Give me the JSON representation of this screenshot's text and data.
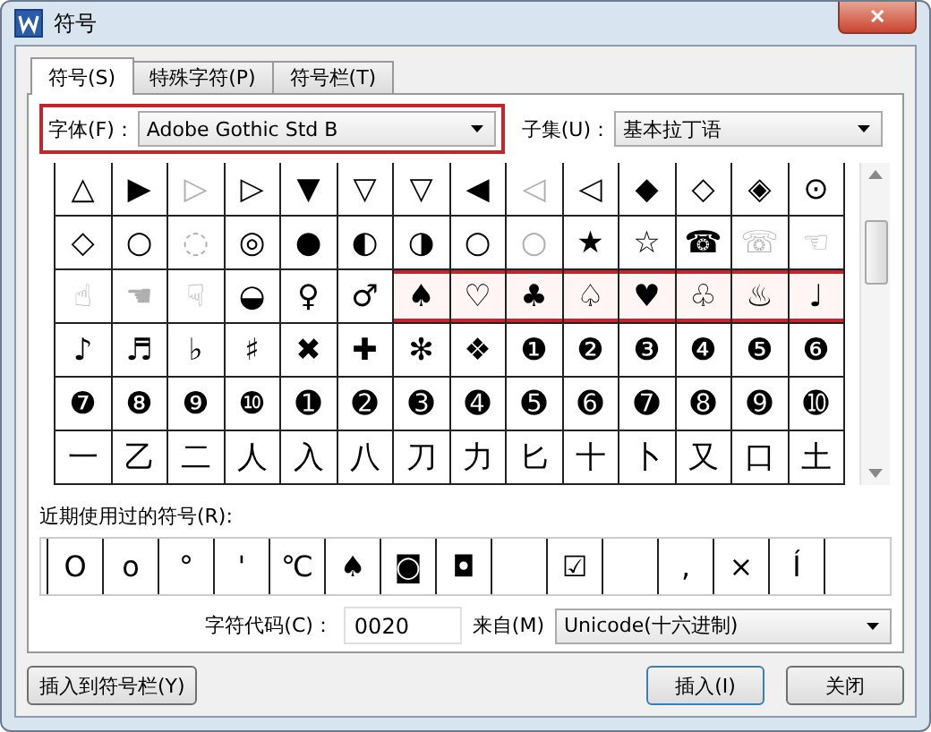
{
  "window": {
    "title": "符号",
    "close": "✕"
  },
  "tabs": [
    {
      "label": "符号(S)",
      "selected": true
    },
    {
      "label": "特殊字符(P)",
      "selected": false
    },
    {
      "label": "符号栏(T)",
      "selected": false
    }
  ],
  "font": {
    "label": "字体(F)：",
    "value": "Adobe Gothic Std B",
    "highlighted": true
  },
  "subset": {
    "label": "子集(U)：",
    "value": "基本拉丁语"
  },
  "grid": [
    [
      {
        "ch": "△",
        "faded": false,
        "highlighted": false
      },
      {
        "ch": "▶",
        "faded": false,
        "highlighted": false
      },
      {
        "ch": "▷",
        "faded": true,
        "highlighted": false
      },
      {
        "ch": "▷",
        "faded": false,
        "highlighted": false
      },
      {
        "ch": "▼",
        "faded": false,
        "highlighted": false
      },
      {
        "ch": "▽",
        "faded": false,
        "highlighted": false
      },
      {
        "ch": "▽",
        "faded": false,
        "highlighted": false
      },
      {
        "ch": "◀",
        "faded": false,
        "highlighted": false
      },
      {
        "ch": "◁",
        "faded": true,
        "highlighted": false
      },
      {
        "ch": "◁",
        "faded": false,
        "highlighted": false
      },
      {
        "ch": "◆",
        "faded": false,
        "highlighted": false
      },
      {
        "ch": "◇",
        "faded": false,
        "highlighted": false
      },
      {
        "ch": "◈",
        "faded": false,
        "highlighted": false
      },
      {
        "ch": "⊙",
        "faded": false,
        "highlighted": false
      }
    ],
    [
      {
        "ch": "◇",
        "faded": false,
        "highlighted": false
      },
      {
        "ch": "○",
        "faded": false,
        "highlighted": false
      },
      {
        "ch": "◌",
        "faded": true,
        "highlighted": false
      },
      {
        "ch": "◎",
        "faded": false,
        "highlighted": false
      },
      {
        "ch": "●",
        "faded": false,
        "highlighted": false
      },
      {
        "ch": "◐",
        "faded": false,
        "highlighted": false
      },
      {
        "ch": "◑",
        "faded": false,
        "highlighted": false
      },
      {
        "ch": "○",
        "faded": false,
        "highlighted": false
      },
      {
        "ch": "○",
        "faded": true,
        "highlighted": false
      },
      {
        "ch": "★",
        "faded": false,
        "highlighted": false
      },
      {
        "ch": "☆",
        "faded": false,
        "highlighted": false
      },
      {
        "ch": "☎",
        "faded": false,
        "highlighted": false
      },
      {
        "ch": "☏",
        "faded": true,
        "highlighted": false
      },
      {
        "ch": "☜",
        "faded": true,
        "highlighted": false
      }
    ],
    [
      {
        "ch": "☝",
        "faded": true,
        "highlighted": false
      },
      {
        "ch": "☚",
        "faded": true,
        "highlighted": false
      },
      {
        "ch": "☟",
        "faded": true,
        "highlighted": false
      },
      {
        "ch": "◒",
        "faded": false,
        "highlighted": false
      },
      {
        "ch": "♀",
        "faded": false,
        "highlighted": false
      },
      {
        "ch": "♂",
        "faded": false,
        "highlighted": false
      },
      {
        "ch": "♠",
        "faded": false,
        "highlighted": true
      },
      {
        "ch": "♡",
        "faded": false,
        "highlighted": true
      },
      {
        "ch": "♣",
        "faded": false,
        "highlighted": true
      },
      {
        "ch": "♤",
        "faded": false,
        "highlighted": true
      },
      {
        "ch": "♥",
        "faded": false,
        "highlighted": true
      },
      {
        "ch": "♧",
        "faded": false,
        "highlighted": true
      },
      {
        "ch": "♨",
        "faded": false,
        "highlighted": true
      },
      {
        "ch": "♩",
        "faded": false,
        "highlighted": true
      }
    ],
    [
      {
        "ch": "♪",
        "faded": false,
        "highlighted": false
      },
      {
        "ch": "♬",
        "faded": false,
        "highlighted": false
      },
      {
        "ch": "♭",
        "faded": false,
        "highlighted": false
      },
      {
        "ch": "♯",
        "faded": false,
        "highlighted": false
      },
      {
        "ch": "✖",
        "faded": false,
        "highlighted": false
      },
      {
        "ch": "✚",
        "faded": false,
        "highlighted": false
      },
      {
        "ch": "✻",
        "faded": false,
        "highlighted": false
      },
      {
        "ch": "❖",
        "faded": false,
        "highlighted": false
      },
      {
        "ch": "❶",
        "faded": false,
        "highlighted": false
      },
      {
        "ch": "❷",
        "faded": false,
        "highlighted": false
      },
      {
        "ch": "❸",
        "faded": false,
        "highlighted": false
      },
      {
        "ch": "❹",
        "faded": false,
        "highlighted": false
      },
      {
        "ch": "❺",
        "faded": false,
        "highlighted": false
      },
      {
        "ch": "❻",
        "faded": false,
        "highlighted": false
      }
    ],
    [
      {
        "ch": "❼",
        "faded": false,
        "highlighted": false
      },
      {
        "ch": "❽",
        "faded": false,
        "highlighted": false
      },
      {
        "ch": "❾",
        "faded": false,
        "highlighted": false
      },
      {
        "ch": "❿",
        "faded": false,
        "highlighted": false
      },
      {
        "ch": "➊",
        "faded": false,
        "highlighted": false
      },
      {
        "ch": "➋",
        "faded": false,
        "highlighted": false
      },
      {
        "ch": "➌",
        "faded": false,
        "highlighted": false
      },
      {
        "ch": "➍",
        "faded": false,
        "highlighted": false
      },
      {
        "ch": "➎",
        "faded": false,
        "highlighted": false
      },
      {
        "ch": "➏",
        "faded": false,
        "highlighted": false
      },
      {
        "ch": "➐",
        "faded": false,
        "highlighted": false
      },
      {
        "ch": "➑",
        "faded": false,
        "highlighted": false
      },
      {
        "ch": "➒",
        "faded": false,
        "highlighted": false
      },
      {
        "ch": "➓",
        "faded": false,
        "highlighted": false
      }
    ],
    [
      {
        "ch": "一",
        "faded": false,
        "highlighted": false
      },
      {
        "ch": "乙",
        "faded": false,
        "highlighted": false
      },
      {
        "ch": "二",
        "faded": false,
        "highlighted": false
      },
      {
        "ch": "人",
        "faded": false,
        "highlighted": false
      },
      {
        "ch": "入",
        "faded": false,
        "highlighted": false
      },
      {
        "ch": "八",
        "faded": false,
        "highlighted": false
      },
      {
        "ch": "刀",
        "faded": false,
        "highlighted": false
      },
      {
        "ch": "力",
        "faded": false,
        "highlighted": false
      },
      {
        "ch": "匕",
        "faded": false,
        "highlighted": false
      },
      {
        "ch": "十",
        "faded": false,
        "highlighted": false
      },
      {
        "ch": "卜",
        "faded": false,
        "highlighted": false
      },
      {
        "ch": "又",
        "faded": false,
        "highlighted": false
      },
      {
        "ch": "口",
        "faded": false,
        "highlighted": false
      },
      {
        "ch": "土",
        "faded": false,
        "highlighted": false
      }
    ]
  ],
  "recent": {
    "label": "近期使用过的符号(R):",
    "items": [
      {
        "kind": "char",
        "ch": "O"
      },
      {
        "kind": "char",
        "ch": "o"
      },
      {
        "kind": "char",
        "ch": "°"
      },
      {
        "kind": "char",
        "ch": "'"
      },
      {
        "kind": "char",
        "ch": "℃"
      },
      {
        "kind": "char",
        "ch": "♠"
      },
      {
        "kind": "char",
        "ch": "◙"
      },
      {
        "kind": "char",
        "ch": "◘"
      },
      {
        "kind": "blank"
      },
      {
        "kind": "char",
        "ch": "☑"
      },
      {
        "kind": "blank"
      },
      {
        "kind": "char",
        "ch": ","
      },
      {
        "kind": "char",
        "ch": "×"
      },
      {
        "kind": "char",
        "ch": "Í"
      },
      {
        "kind": "blank"
      }
    ]
  },
  "code": {
    "label": "字符代码(C)：",
    "value": "0020"
  },
  "from": {
    "label": "来自(M)",
    "value": "Unicode(十六进制)"
  },
  "buttons": {
    "add_to_bar": "插入到符号栏(Y)",
    "insert": "插入(I)",
    "close": "关闭"
  }
}
